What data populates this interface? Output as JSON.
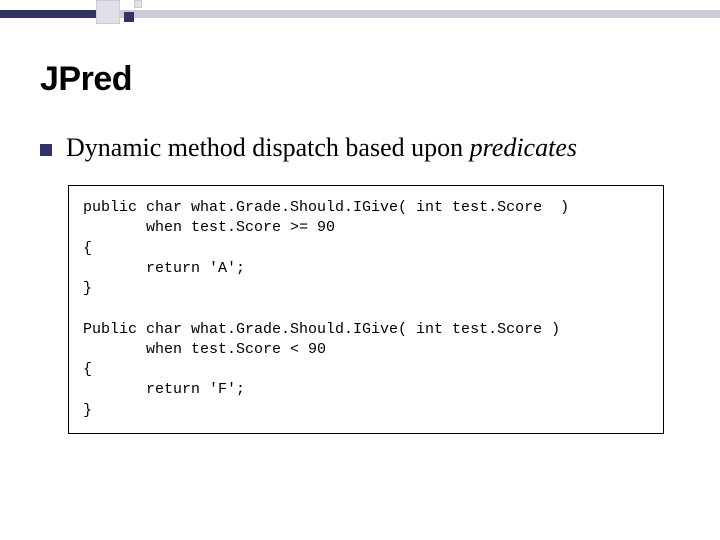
{
  "slide": {
    "title": "JPred",
    "bullet_prefix": "Dynamic method dispatch based upon ",
    "bullet_italic": "predicates",
    "code": "public char what.Grade.Should.IGive( int test.Score  )\n       when test.Score >= 90\n{\n       return 'A';\n}\n\nPublic char what.Grade.Should.IGive( int test.Score )\n       when test.Score < 90\n{\n       return 'F';\n}"
  }
}
